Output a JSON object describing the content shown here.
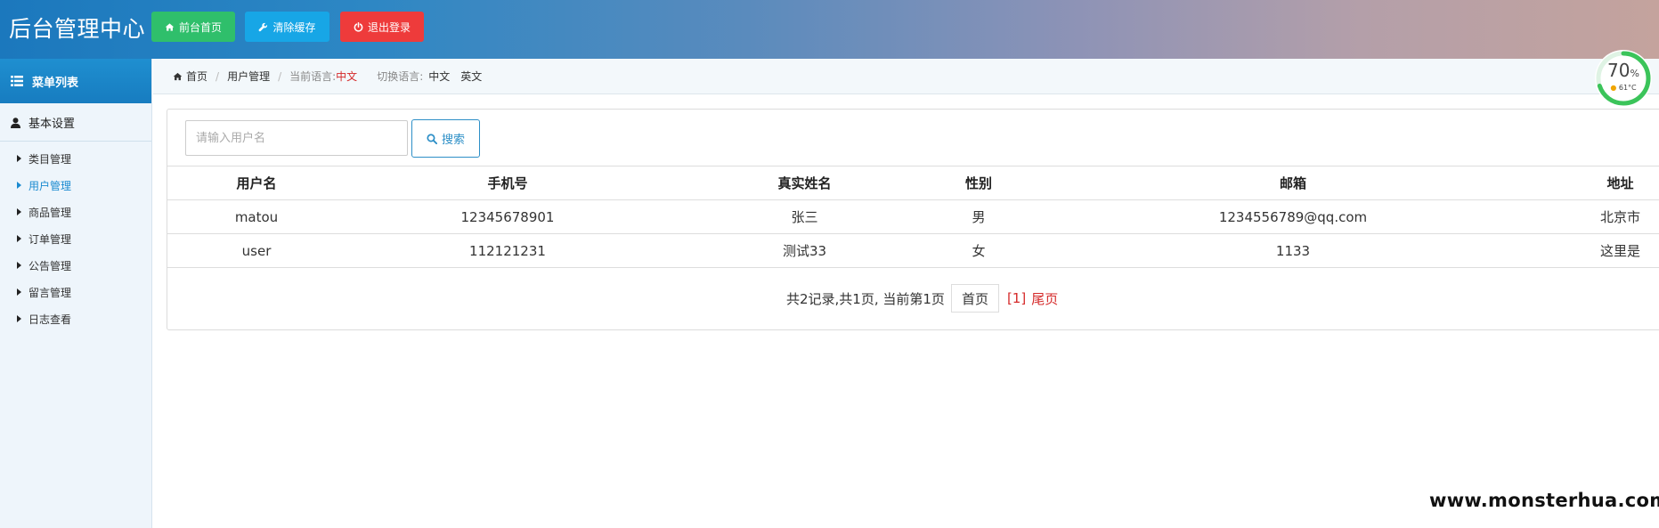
{
  "header": {
    "title": "后台管理中心",
    "buttons": {
      "home": "前台首页",
      "clear_cache": "清除缓存",
      "logout": "退出登录"
    },
    "colors": {
      "home": "#2fbf6b",
      "clear_cache": "#17a6e6",
      "logout": "#ee3b3b"
    }
  },
  "sidebar": {
    "menu_title": "菜单列表",
    "group": "基本设置",
    "items": [
      {
        "label": "类目管理",
        "active": false
      },
      {
        "label": "用户管理",
        "active": true
      },
      {
        "label": "商品管理",
        "active": false
      },
      {
        "label": "订单管理",
        "active": false
      },
      {
        "label": "公告管理",
        "active": false
      },
      {
        "label": "留言管理",
        "active": false
      },
      {
        "label": "日志查看",
        "active": false
      }
    ]
  },
  "breadcrumb": {
    "home": "首页",
    "current": "用户管理",
    "lang_label": "当前语言:",
    "lang_value": "中文",
    "switch_label": "切换语言:",
    "switch_zh": "中文",
    "switch_en": "英文"
  },
  "gauge": {
    "percent": 70,
    "percent_text": "70",
    "unit": "%",
    "temp": "61°C"
  },
  "search": {
    "placeholder": "请输入用户名",
    "button": "搜索"
  },
  "table": {
    "headers": [
      "用户名",
      "手机号",
      "真实姓名",
      "性别",
      "邮箱",
      "地址"
    ],
    "rows": [
      [
        "matou",
        "12345678901",
        "张三",
        "男",
        "1234556789@qq.com",
        "北京市"
      ],
      [
        "user",
        "112121231",
        "测试33",
        "女",
        "1133",
        "这里是"
      ]
    ]
  },
  "pager": {
    "summary": "共2记录,共1页, 当前第1页",
    "first": "首页",
    "current": "[1]",
    "last": "尾页"
  },
  "watermark": "www.monsterhua.com"
}
